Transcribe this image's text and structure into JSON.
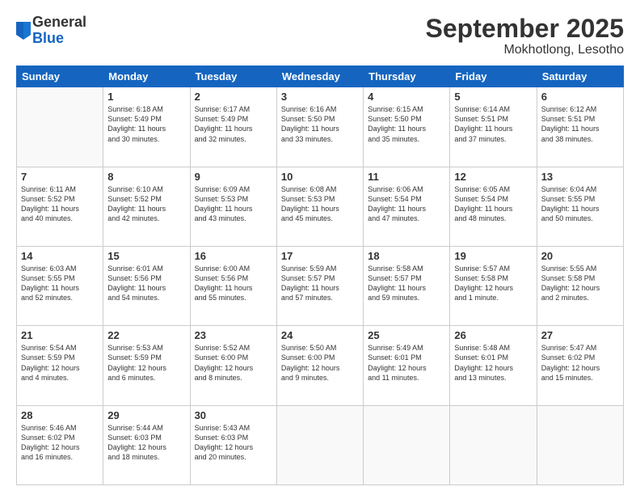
{
  "header": {
    "logo_general": "General",
    "logo_blue": "Blue",
    "title": "September 2025",
    "subtitle": "Mokhotlong, Lesotho"
  },
  "days_of_week": [
    "Sunday",
    "Monday",
    "Tuesday",
    "Wednesday",
    "Thursday",
    "Friday",
    "Saturday"
  ],
  "weeks": [
    [
      {
        "day": "",
        "info": ""
      },
      {
        "day": "1",
        "info": "Sunrise: 6:18 AM\nSunset: 5:49 PM\nDaylight: 11 hours\nand 30 minutes."
      },
      {
        "day": "2",
        "info": "Sunrise: 6:17 AM\nSunset: 5:49 PM\nDaylight: 11 hours\nand 32 minutes."
      },
      {
        "day": "3",
        "info": "Sunrise: 6:16 AM\nSunset: 5:50 PM\nDaylight: 11 hours\nand 33 minutes."
      },
      {
        "day": "4",
        "info": "Sunrise: 6:15 AM\nSunset: 5:50 PM\nDaylight: 11 hours\nand 35 minutes."
      },
      {
        "day": "5",
        "info": "Sunrise: 6:14 AM\nSunset: 5:51 PM\nDaylight: 11 hours\nand 37 minutes."
      },
      {
        "day": "6",
        "info": "Sunrise: 6:12 AM\nSunset: 5:51 PM\nDaylight: 11 hours\nand 38 minutes."
      }
    ],
    [
      {
        "day": "7",
        "info": "Sunrise: 6:11 AM\nSunset: 5:52 PM\nDaylight: 11 hours\nand 40 minutes."
      },
      {
        "day": "8",
        "info": "Sunrise: 6:10 AM\nSunset: 5:52 PM\nDaylight: 11 hours\nand 42 minutes."
      },
      {
        "day": "9",
        "info": "Sunrise: 6:09 AM\nSunset: 5:53 PM\nDaylight: 11 hours\nand 43 minutes."
      },
      {
        "day": "10",
        "info": "Sunrise: 6:08 AM\nSunset: 5:53 PM\nDaylight: 11 hours\nand 45 minutes."
      },
      {
        "day": "11",
        "info": "Sunrise: 6:06 AM\nSunset: 5:54 PM\nDaylight: 11 hours\nand 47 minutes."
      },
      {
        "day": "12",
        "info": "Sunrise: 6:05 AM\nSunset: 5:54 PM\nDaylight: 11 hours\nand 48 minutes."
      },
      {
        "day": "13",
        "info": "Sunrise: 6:04 AM\nSunset: 5:55 PM\nDaylight: 11 hours\nand 50 minutes."
      }
    ],
    [
      {
        "day": "14",
        "info": "Sunrise: 6:03 AM\nSunset: 5:55 PM\nDaylight: 11 hours\nand 52 minutes."
      },
      {
        "day": "15",
        "info": "Sunrise: 6:01 AM\nSunset: 5:56 PM\nDaylight: 11 hours\nand 54 minutes."
      },
      {
        "day": "16",
        "info": "Sunrise: 6:00 AM\nSunset: 5:56 PM\nDaylight: 11 hours\nand 55 minutes."
      },
      {
        "day": "17",
        "info": "Sunrise: 5:59 AM\nSunset: 5:57 PM\nDaylight: 11 hours\nand 57 minutes."
      },
      {
        "day": "18",
        "info": "Sunrise: 5:58 AM\nSunset: 5:57 PM\nDaylight: 11 hours\nand 59 minutes."
      },
      {
        "day": "19",
        "info": "Sunrise: 5:57 AM\nSunset: 5:58 PM\nDaylight: 12 hours\nand 1 minute."
      },
      {
        "day": "20",
        "info": "Sunrise: 5:55 AM\nSunset: 5:58 PM\nDaylight: 12 hours\nand 2 minutes."
      }
    ],
    [
      {
        "day": "21",
        "info": "Sunrise: 5:54 AM\nSunset: 5:59 PM\nDaylight: 12 hours\nand 4 minutes."
      },
      {
        "day": "22",
        "info": "Sunrise: 5:53 AM\nSunset: 5:59 PM\nDaylight: 12 hours\nand 6 minutes."
      },
      {
        "day": "23",
        "info": "Sunrise: 5:52 AM\nSunset: 6:00 PM\nDaylight: 12 hours\nand 8 minutes."
      },
      {
        "day": "24",
        "info": "Sunrise: 5:50 AM\nSunset: 6:00 PM\nDaylight: 12 hours\nand 9 minutes."
      },
      {
        "day": "25",
        "info": "Sunrise: 5:49 AM\nSunset: 6:01 PM\nDaylight: 12 hours\nand 11 minutes."
      },
      {
        "day": "26",
        "info": "Sunrise: 5:48 AM\nSunset: 6:01 PM\nDaylight: 12 hours\nand 13 minutes."
      },
      {
        "day": "27",
        "info": "Sunrise: 5:47 AM\nSunset: 6:02 PM\nDaylight: 12 hours\nand 15 minutes."
      }
    ],
    [
      {
        "day": "28",
        "info": "Sunrise: 5:46 AM\nSunset: 6:02 PM\nDaylight: 12 hours\nand 16 minutes."
      },
      {
        "day": "29",
        "info": "Sunrise: 5:44 AM\nSunset: 6:03 PM\nDaylight: 12 hours\nand 18 minutes."
      },
      {
        "day": "30",
        "info": "Sunrise: 5:43 AM\nSunset: 6:03 PM\nDaylight: 12 hours\nand 20 minutes."
      },
      {
        "day": "",
        "info": ""
      },
      {
        "day": "",
        "info": ""
      },
      {
        "day": "",
        "info": ""
      },
      {
        "day": "",
        "info": ""
      }
    ]
  ]
}
